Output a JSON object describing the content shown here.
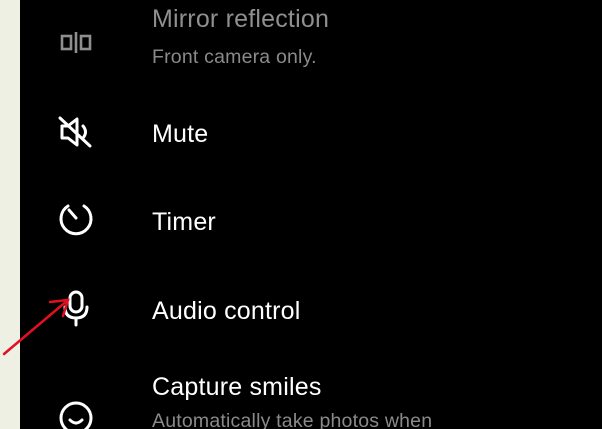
{
  "settings": {
    "items": [
      {
        "title": "Mirror reflection",
        "subtitle": "Front camera only.",
        "icon": "mirror-icon"
      },
      {
        "title": "Mute",
        "icon": "volume-mute-icon"
      },
      {
        "title": "Timer",
        "icon": "timer-icon"
      },
      {
        "title": "Audio control",
        "icon": "microphone-icon"
      },
      {
        "title": "Capture smiles",
        "subtitle": "Automatically take photos when",
        "icon": "smile-icon"
      }
    ]
  },
  "colors": {
    "background": "#000000",
    "text": "#ffffff",
    "secondary_text": "#8a8a8a",
    "annotation_arrow": "#e01020",
    "page_background": "#eef0e4"
  }
}
